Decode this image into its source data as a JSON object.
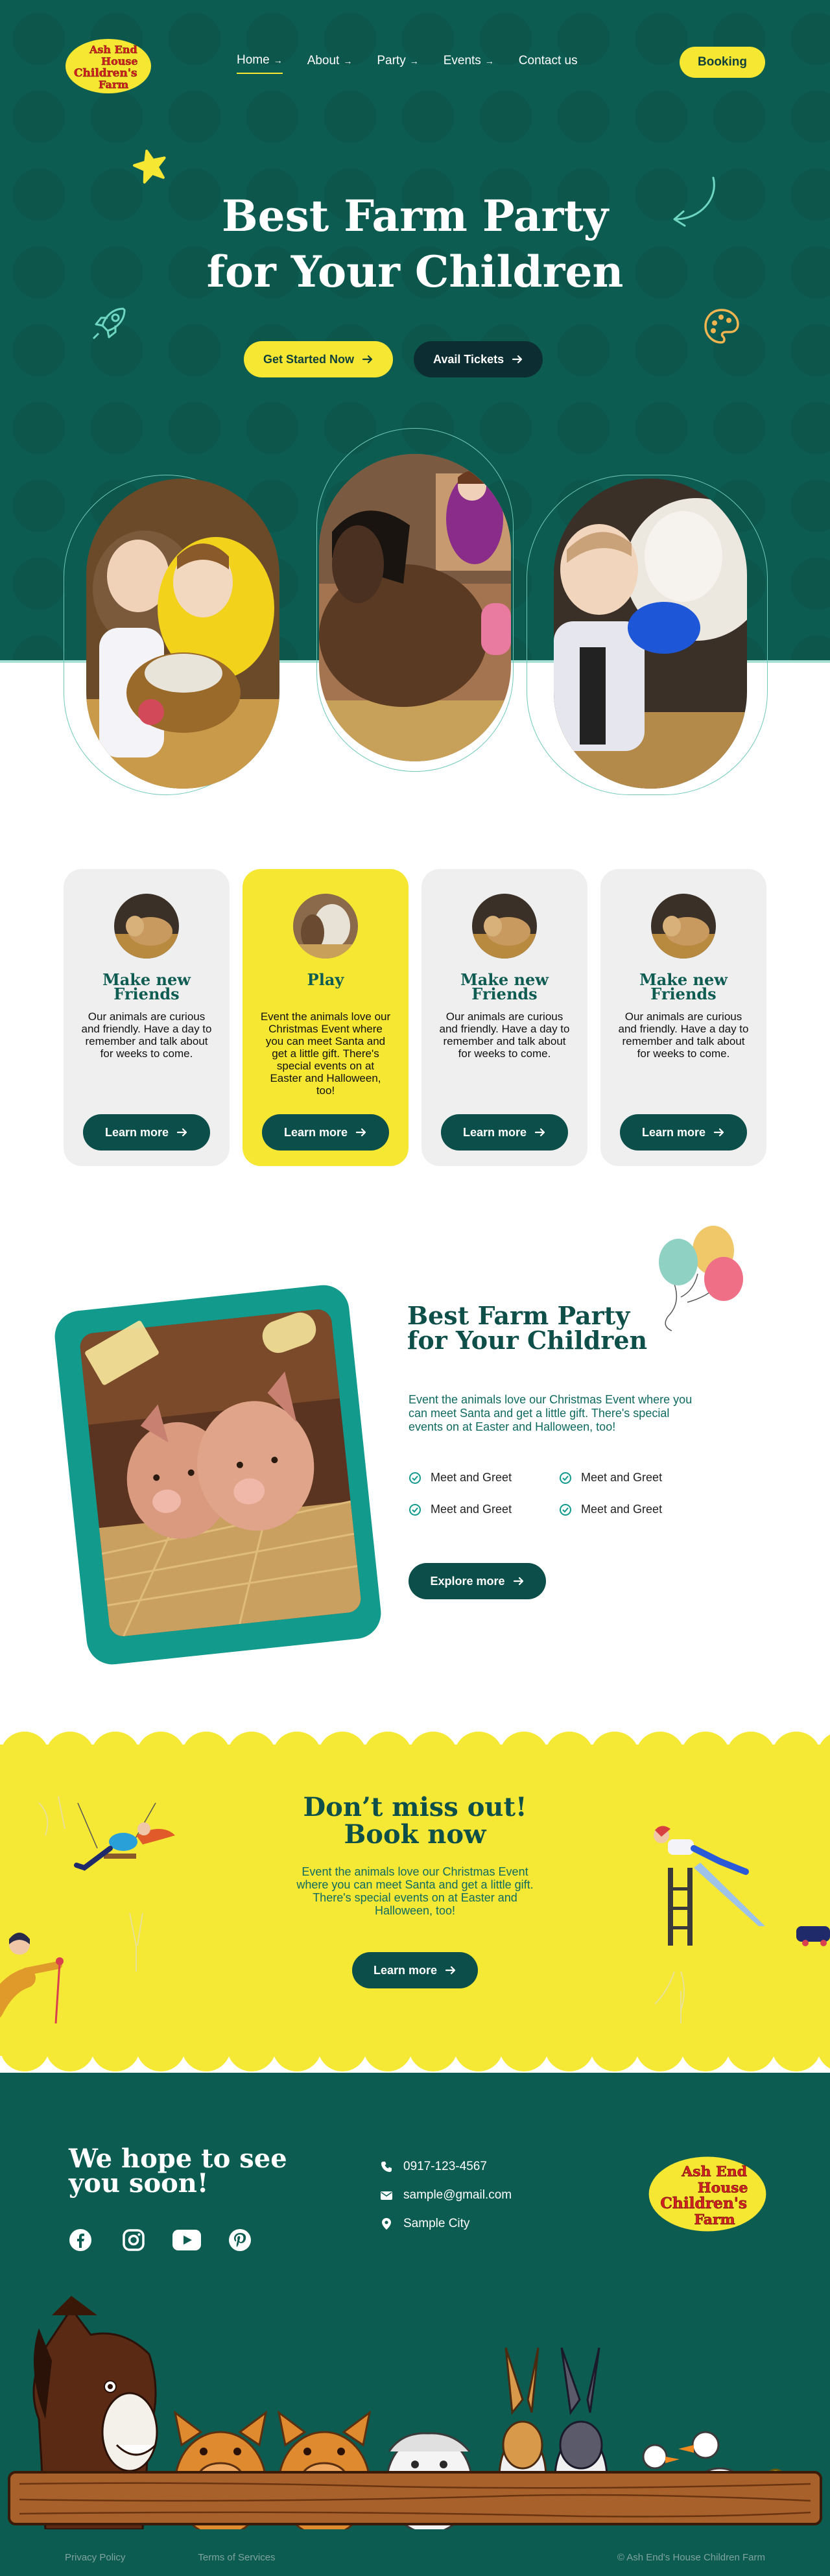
{
  "logo": {
    "line1": "Ash End",
    "line2": "House",
    "line3": "Children's",
    "line4": "Farm"
  },
  "nav": {
    "items": [
      {
        "label": "Home",
        "arrow": "→"
      },
      {
        "label": "About",
        "arrow": "→"
      },
      {
        "label": "Party",
        "arrow": "→"
      },
      {
        "label": "Events",
        "arrow": "→"
      },
      {
        "label": "Contact us",
        "arrow": ""
      }
    ],
    "booking": "Booking"
  },
  "hero": {
    "title_line1": "Best Farm Party",
    "title_line2": "for Your Children",
    "cta_primary": "Get Started Now",
    "cta_secondary": "Avail Tickets",
    "photos": [
      "children-with-rabbits-photo",
      "girl-petting-pony-photo",
      "boy-feeding-sheep-photo"
    ]
  },
  "cards": [
    {
      "title": "Make new Friends",
      "text": "Our animals are curious and friendly. Have a day to remember and talk about for weeks to come.",
      "button": "Learn more"
    },
    {
      "title": "Play",
      "text": "Event the animals love our Christmas Event where you can meet Santa and get a little gift. There's special events on at Easter and Halloween, too!",
      "button": "Learn more"
    },
    {
      "title": "Make new Friends",
      "text": "Our animals are curious and friendly. Have a day to remember and talk about for weeks to come.",
      "button": "Learn more"
    },
    {
      "title": "Make new Friends",
      "text": "Our animals are curious and friendly. Have a day to remember and talk about for weeks to come.",
      "button": "Learn more"
    }
  ],
  "about": {
    "title": "Best Farm Party for Your Children",
    "text": "Event the animals love our Christmas Event where you can meet Santa and get a little gift. There's special events on at Easter and Halloween, too!",
    "checks": [
      "Meet and Greet",
      "Meet and Greet",
      "Meet and Greet",
      "Meet and Greet"
    ],
    "button": "Explore more"
  },
  "promo": {
    "title_line1": "Don’t miss out!",
    "title_line2": "Book now",
    "text": "Event the animals love our Christmas Event where you can meet Santa and get a little gift. There's special events on at Easter and Halloween, too!",
    "button": "Learn more"
  },
  "footer": {
    "title": "We hope to see you soon!",
    "phone": "0917-123-4567",
    "email": "sample@gmail.com",
    "city": "Sample City",
    "privacy": "Privacy Policy",
    "terms": "Terms of Services",
    "copyright": "© Ash End's House Children Farm"
  },
  "colors": {
    "primary": "#0d5c52",
    "accent": "#f6e733",
    "dark": "#0c4e4a"
  }
}
